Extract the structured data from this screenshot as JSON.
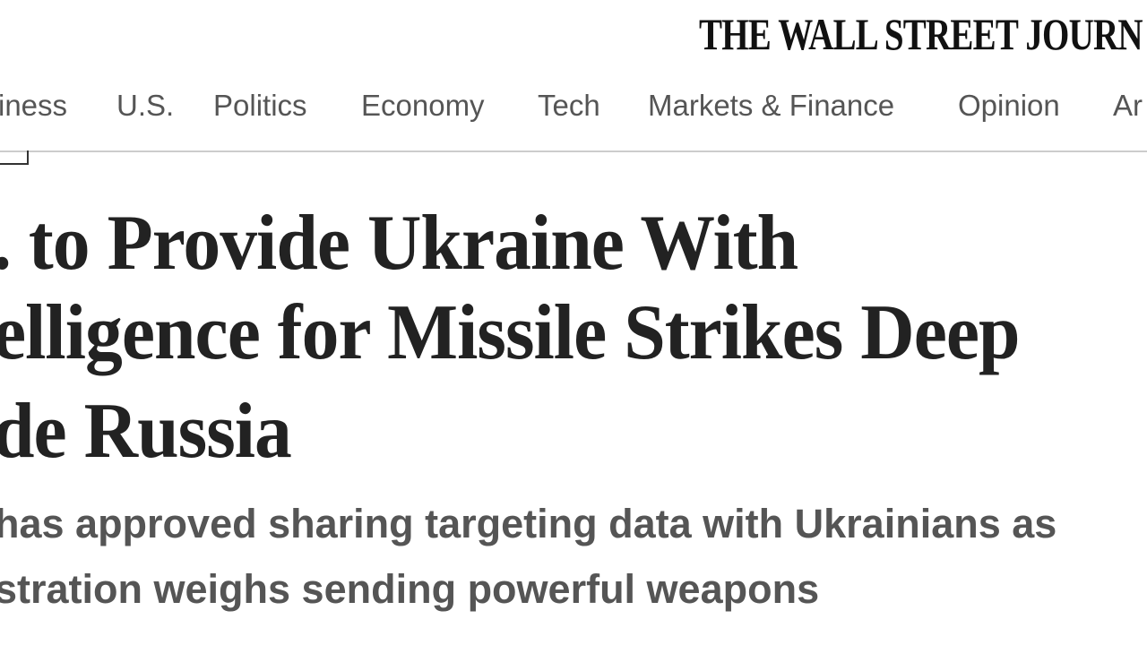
{
  "masthead": {
    "text": "THE WALL STREET JOURN"
  },
  "nav": {
    "items": [
      {
        "label": "iness"
      },
      {
        "label": "U.S."
      },
      {
        "label": "Politics"
      },
      {
        "label": "Economy"
      },
      {
        "label": "Tech"
      },
      {
        "label": "Markets & Finance"
      },
      {
        "label": "Opinion"
      },
      {
        "label": "Ar"
      }
    ]
  },
  "article": {
    "headline_lines": [
      ". to Provide Ukraine With",
      "elligence for Missile Strikes Deep",
      "de Russia"
    ],
    "dek_lines": [
      " has approved sharing targeting data with Ukrainians as",
      "stration weighs sending powerful weapons"
    ]
  }
}
